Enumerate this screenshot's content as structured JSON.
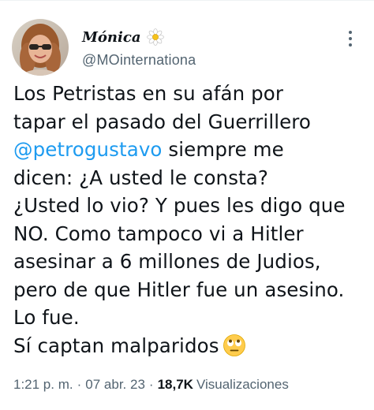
{
  "author": {
    "display_name": "Mónica",
    "name_icon": "daisy-flower-icon",
    "handle": "@MOinternationa",
    "avatar_icon": "profile-avatar"
  },
  "menu": {
    "icon": "more-options-icon"
  },
  "tweet": {
    "lines": [
      "Los Petristas en su afán por",
      "tapar el pasado del Guerrillero",
      "siempre me",
      "dicen: ¿A usted le consta?",
      "¿Usted lo vio? Y pues les digo que",
      "NO. Como tampoco vi a Hitler",
      "asesinar a 6 millones de Judios,",
      "pero de que Hitler fue un asesino.",
      "Lo fue.",
      "Sí captan malparidos"
    ],
    "mention": "@petrogustavo",
    "end_emoji": "rolling-eyes-emoji-icon"
  },
  "meta": {
    "time": "1:21 p. m.",
    "separator": "·",
    "date": "07 abr. 23",
    "views_count": "18,7K",
    "views_label": "Visualizaciones"
  },
  "colors": {
    "text": "#0f1419",
    "secondary": "#536471",
    "link": "#1d9bf0"
  }
}
